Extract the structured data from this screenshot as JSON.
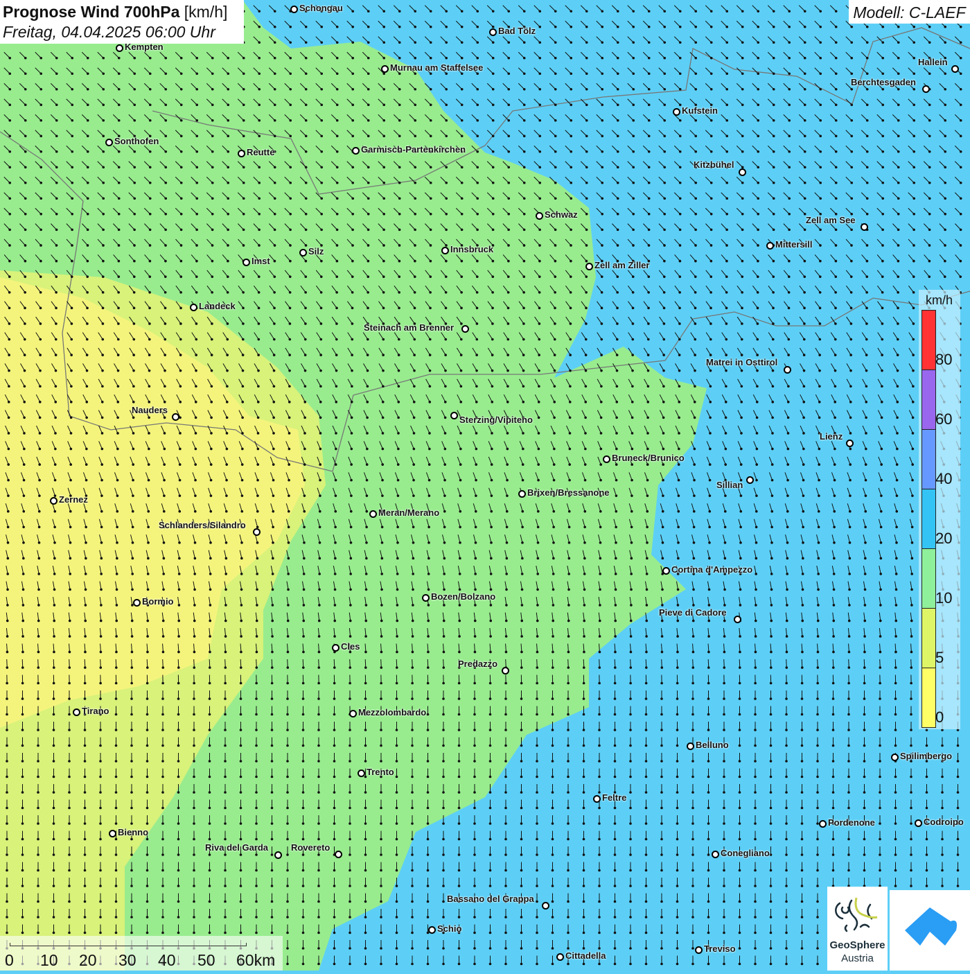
{
  "title": {
    "main": "Prognose Wind 700hPa",
    "unit": "[km/h]",
    "datetime": "Freitag, 04.04.2025 06:00 Uhr"
  },
  "model": "Modell: C-LAEF",
  "legend": {
    "unit": "km/h",
    "ticks": [
      "80",
      "60",
      "40",
      "20",
      "10",
      "5",
      "0"
    ],
    "colors": [
      "#ff3333",
      "#9966ee",
      "#6699ff",
      "#33c4f5",
      "#8ef09a",
      "#ddf566",
      "#ffff66"
    ]
  },
  "map_colors": {
    "cyan": "#5dcff6",
    "green": "#98ec8e",
    "yellow": "#f4f47c",
    "yellowgreen": "#d8f27a"
  },
  "cities": [
    "Schongau",
    "Bad Tölz",
    "Kempten",
    "Murnau am Staffelsee",
    "Hallein",
    "Berchtesgaden",
    "Kufstein",
    "Sonthofen",
    "Reutte",
    "Garmisch-Partenkirchen",
    "Kitzbühel",
    "Schwaz",
    "Zell am See",
    "Mittersill",
    "Innsbruck",
    "Silz",
    "Imst",
    "Zell am Ziller",
    "Landeck",
    "Steinach am Brenner",
    "Matrei in Osttirol",
    "Nauders",
    "Sterzing/Vipiteno",
    "Lienz",
    "Bruneck/Brunico",
    "Sillian",
    "Brixen/Bressanone",
    "Zernez",
    "Meran/Merano",
    "Schlanders/Silandro",
    "Cortina d'Ampezzo",
    "Bozen/Bolzano",
    "Bormio",
    "Pieve di Cadore",
    "Cles",
    "Predazzo",
    "Tirano",
    "Mezzolombardo",
    "Belluno",
    "Spilimbergo",
    "Trento",
    "Feltre",
    "Pordenone",
    "Codroipo",
    "Bienno",
    "Riva del Garda",
    "Rovereto",
    "Conegliano",
    "Bassano del Grappa",
    "Schio",
    "Treviso",
    "Cittadella"
  ],
  "scale": {
    "labels": [
      "0",
      "10",
      "20",
      "30",
      "40",
      "50",
      "60km"
    ]
  },
  "logos": {
    "geosphere_line1": "GeoSphere",
    "geosphere_line2": "Austria"
  }
}
